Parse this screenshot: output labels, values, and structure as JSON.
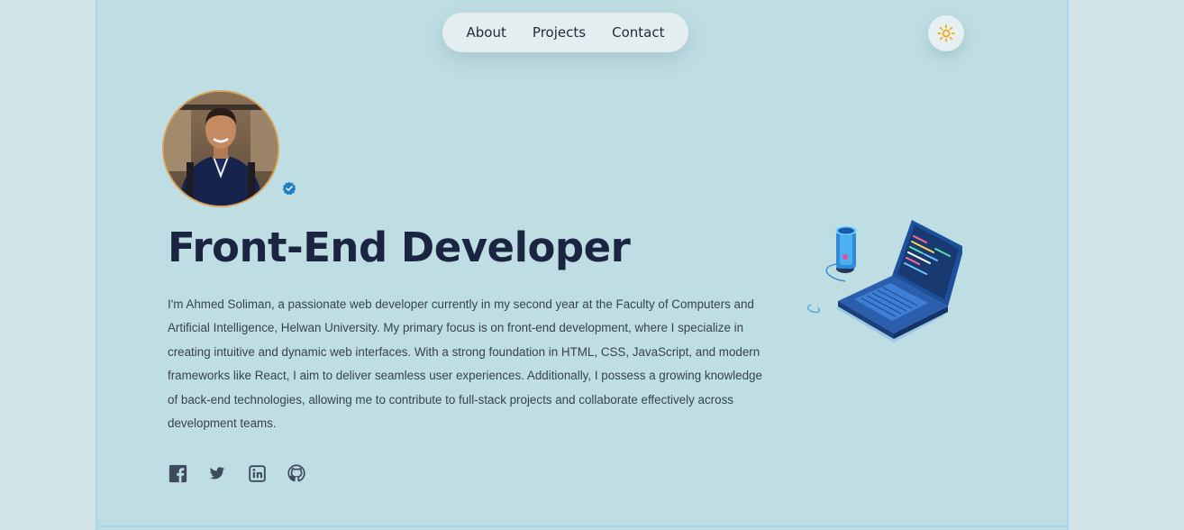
{
  "nav": {
    "items": [
      {
        "label": "About"
      },
      {
        "label": "Projects"
      },
      {
        "label": "Contact"
      }
    ]
  },
  "theme_toggle": {
    "icon": "sun-icon",
    "color": "#f5a300"
  },
  "profile": {
    "avatar_icon": "profile-photo",
    "verified_icon": "verified-badge-icon",
    "verified_color": "#1d7fc4"
  },
  "hero": {
    "title": "Front-End Developer",
    "bio": "I'm Ahmed Soliman, a passionate web developer currently in my second year at the Faculty of Computers and Artificial Intelligence, Helwan University. My primary focus is on front-end development, where I specialize in creating intuitive and dynamic web interfaces. With a strong foundation in HTML, CSS, JavaScript, and modern frameworks like React, I aim to deliver seamless user experiences. Additionally, I possess a growing knowledge of back-end technologies, allowing me to contribute to full-stack projects and collaborate effectively across development teams."
  },
  "socials": [
    {
      "icon": "facebook-icon"
    },
    {
      "icon": "twitter-icon"
    },
    {
      "icon": "linkedin-icon"
    },
    {
      "icon": "github-icon"
    }
  ],
  "illustration": {
    "icon": "laptop-coding-illustration"
  }
}
